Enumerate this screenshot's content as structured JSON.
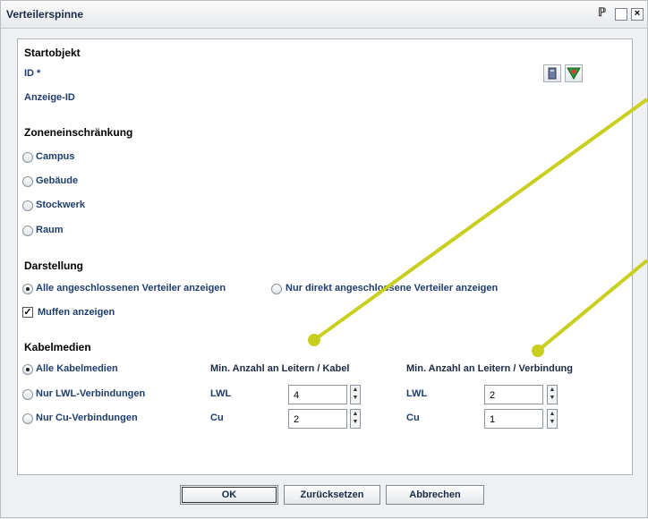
{
  "window": {
    "title": "Verteilerspinne"
  },
  "start": {
    "heading": "Startobjekt",
    "id_label": "ID *",
    "display_id_label": "Anzeige-ID"
  },
  "zone": {
    "heading": "Zoneneinschränkung",
    "options": [
      "Campus",
      "Gebäude",
      "Stockwerk",
      "Raum"
    ]
  },
  "display": {
    "heading": "Darstellung",
    "opt_all": "Alle angeschlossenen Verteiler anzeigen",
    "opt_direct": "Nur direkt angeschlossene Verteiler anzeigen",
    "muffen": "Muffen anzeigen"
  },
  "cable": {
    "heading": "Kabelmedien",
    "options": [
      "Alle Kabelmedien",
      "Nur LWL-Verbindungen",
      "Nur Cu-Verbindungen"
    ],
    "col_cable": "Min. Anzahl an Leitern / Kabel",
    "col_conn": "Min. Anzahl an Leitern / Verbindung",
    "lwl_label": "LWL",
    "cu_label": "Cu",
    "cable_lwl_value": "4",
    "cable_cu_value": "2",
    "conn_lwl_value": "2",
    "conn_cu_value": "1"
  },
  "buttons": {
    "ok": "OK",
    "reset": "Zurücksetzen",
    "cancel": "Abbrechen"
  },
  "icons": {
    "help": "help-icon",
    "maximize": "maximize-icon",
    "close": "close-icon",
    "select": "select-object-icon",
    "filter": "filter-icon"
  },
  "colors": {
    "annotation": "#c9cf1e",
    "label": "#1f3d6b"
  }
}
